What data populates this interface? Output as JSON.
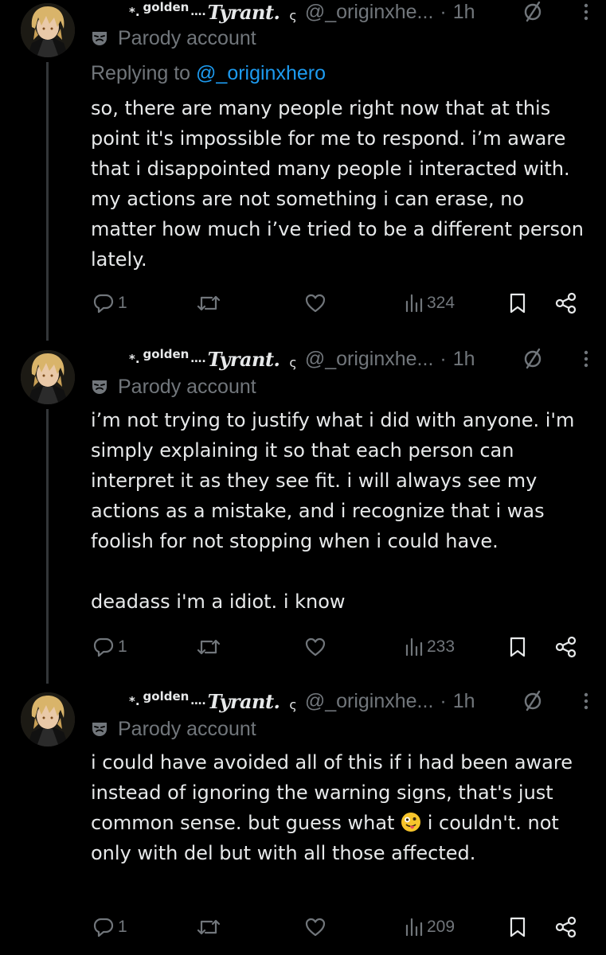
{
  "colors": {
    "background": "#000000",
    "text_primary": "#e7e9ea",
    "text_secondary": "#71767b",
    "link": "#1d9bf0",
    "thread_line": "#333639"
  },
  "author": {
    "prefix_symbol": "*.",
    "name_part1": "golden",
    "name_dots": "….",
    "name_part2": "Tyrant.",
    "name_suffix": "ς",
    "handle": "@_originxhe...",
    "avatar": "avatar-icon"
  },
  "tweets": [
    {
      "time": "1h",
      "parody_label": "Parody account",
      "replying_prefix": "Replying to",
      "replying_handle": "@_originxhero",
      "paragraphs": [
        "so, there are many people right now that at this point it's impossible for me to respond. i’m aware that i disappointed many people i interacted with. my actions are not something i can erase, no matter how much i’ve tried to be a different person lately."
      ],
      "replies": "1",
      "retweets": "",
      "likes": "",
      "views": "324"
    },
    {
      "time": "1h",
      "parody_label": "Parody account",
      "paragraphs": [
        "i’m not trying to justify what i did with anyone. i'm simply explaining it so that each person can interpret it as they see fit. i will always see my actions as a mistake, and i recognize that i was foolish for not stopping when i could have.",
        "deadass i'm a idiot. i know"
      ],
      "replies": "1",
      "retweets": "",
      "likes": "",
      "views": "233"
    },
    {
      "time": "1h",
      "parody_label": "Parody account",
      "paragraph_a": "i could have avoided all of this if i had been aware instead of ignoring the warning signs, that's just common sense. but guess what",
      "emoji": "zany-face-emoji",
      "paragraph_b": "i couldn't. not only with del but with all those affected.",
      "replies": "1",
      "retweets": "",
      "likes": "",
      "views": "209"
    }
  ],
  "icons": {
    "reply": "reply-icon",
    "retweet": "retweet-icon",
    "like": "heart-icon",
    "views": "views-icon",
    "bookmark": "bookmark-icon",
    "share": "share-icon",
    "grok": "grok-icon",
    "more": "more-icon",
    "parody": "parody-mask-icon"
  }
}
